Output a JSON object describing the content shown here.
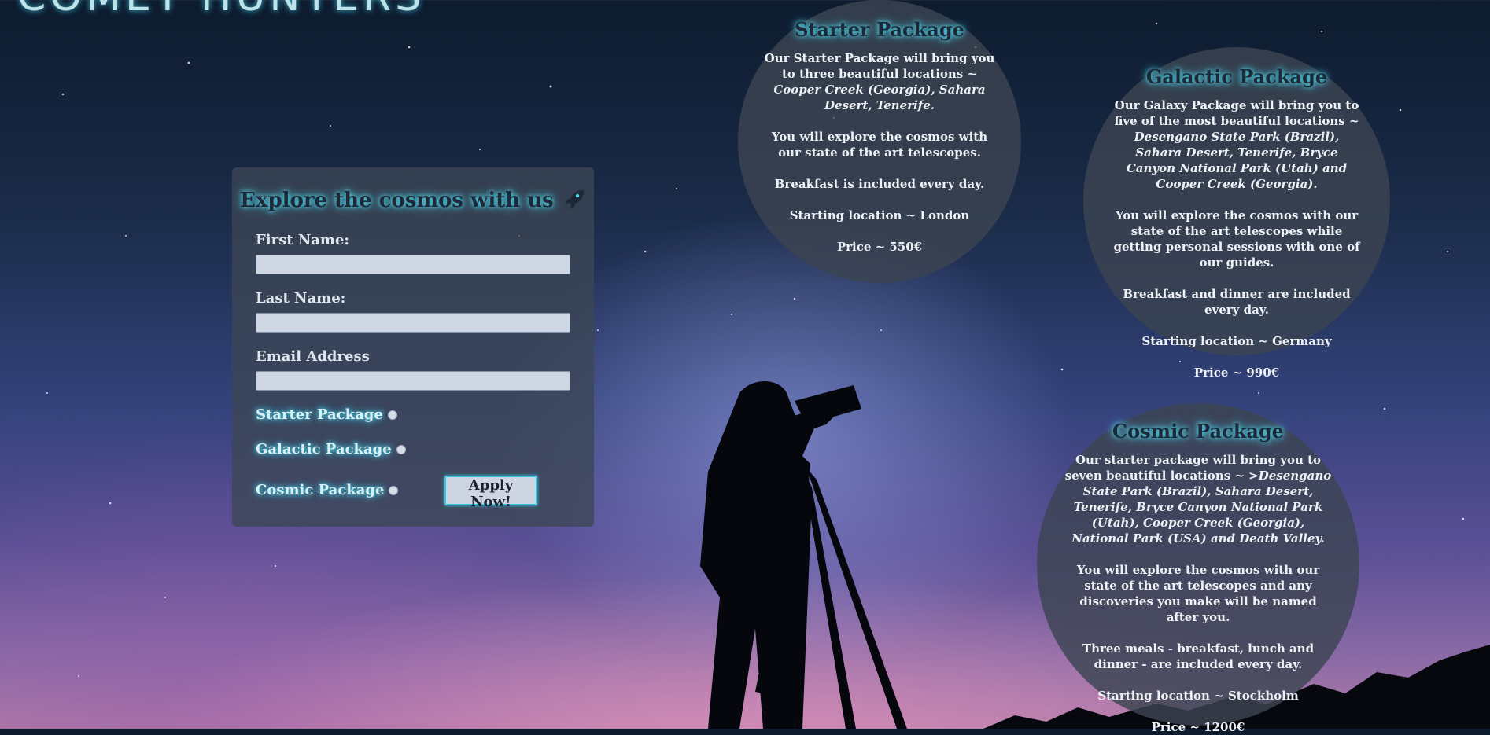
{
  "brand": {
    "title": "COMET HUNTERS"
  },
  "form": {
    "title": "Explore the cosmos with us",
    "title_icon": "rocket-icon",
    "first_name_label": "First Name:",
    "first_name_value": "",
    "last_name_label": "Last Name:",
    "last_name_value": "",
    "email_label": "Email Address",
    "email_value": "",
    "options": [
      "Starter Package",
      "Galactic Package",
      "Cosmic Package"
    ],
    "submit_label": "Apply Now!"
  },
  "packages": {
    "starter": {
      "title": "Starter Package",
      "intro": "Our Starter Package will bring you to three beautiful locations ~ ",
      "locations": "Cooper Creek (Georgia), Sahara Desert, Tenerife.",
      "explore": "You will explore the cosmos with our state of the art telescopes.",
      "meals": "Breakfast is included every day.",
      "start": "Starting location ~ London",
      "price": "Price ~ 550€"
    },
    "galactic": {
      "title": "Galactic Package",
      "intro": "Our Galaxy Package will bring you to five of the most beautiful locations ~ ",
      "locations": "Desengano State Park (Brazil), Sahara Desert, Tenerife, Bryce Canyon National Park (Utah) and Cooper Creek (Georgia).",
      "explore": "You will explore the cosmos with our state of the art telescopes while getting personal sessions with one of our guides.",
      "meals": "Breakfast and dinner are included every day.",
      "start": "Starting location ~ Germany",
      "price": "Price ~ 990€"
    },
    "cosmic": {
      "title": "Cosmic Package",
      "intro": "Our starter package will bring you to seven beautiful locations ~ ",
      "locations": ">Desengano State Park (Brazil), Sahara Desert, Tenerife, Bryce Canyon National Park (Utah), Cooper Creek (Georgia), National Park (USA) and Death Valley.",
      "explore": "You will explore the cosmos with our state of the art telescopes and any discoveries you make will be named after you.",
      "meals": "Three meals - breakfast, lunch and dinner - are included every day.",
      "start": "Starting location ~ Stockholm",
      "price": "Price ~ 1200€"
    }
  },
  "colors": {
    "glow": "#4fd7ea",
    "panel": "#3c4655",
    "button_border": "#36c7db"
  }
}
